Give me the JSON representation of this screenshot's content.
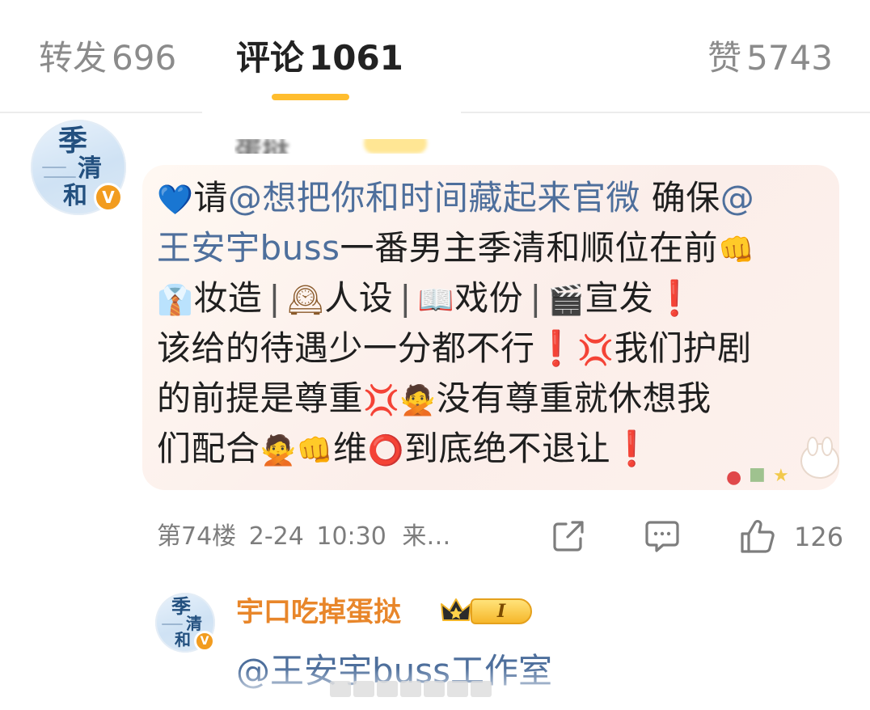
{
  "tabs": {
    "repost": {
      "label": "转发",
      "count": "696"
    },
    "comments": {
      "label": "评论",
      "count": "1061"
    },
    "likes": {
      "label": "赞",
      "count": "5743"
    }
  },
  "comment": {
    "avatar_text": [
      "季",
      "清",
      "和"
    ],
    "verified_badge": "V",
    "username_blurred": "蛋挞",
    "lines": {
      "l1": {
        "emoji1": "💙",
        "t1": "请",
        "mention1": "@想把你和时间藏起来官微",
        "t2": " 确保",
        "mention2a": "@"
      },
      "l2": {
        "mention2b": "王安宇buss",
        "t1": "一番男主季清和顺位在前",
        "emoji1": "👊"
      },
      "l3": {
        "emoji1": "👔",
        "t1": "妆造",
        "sep1": "|",
        "emoji2": "🕰",
        "t2": "人设",
        "sep2": "|",
        "emoji3": "📖",
        "t3": "戏份",
        "sep3": "|",
        "emoji4": "🎬",
        "t4": "宣发",
        "emoji5": "❗"
      },
      "l4": {
        "t1": "该给的待遇少一分都不行",
        "emoji1": "❗",
        "emoji2": "💢",
        "t2": "我们护剧"
      },
      "l5": {
        "t1": "的前提是尊重",
        "emoji1": "💢",
        "emoji2": "🙅",
        "t2": "没有尊重就休想我"
      },
      "l6": {
        "t1": "们配合",
        "emoji1": "🙅",
        "emoji2": "👊",
        "t2": "维",
        "emoji3": "⭕",
        "t3": "到底绝不退让",
        "emoji4": "❗"
      }
    },
    "floor": "第74楼",
    "date": "2-24",
    "time": "10:30",
    "source": "来…",
    "like_count": "126"
  },
  "icons": {
    "share": "share-icon",
    "comment": "comment-icon",
    "like": "thumbs-up-icon",
    "crown": "crown-icon",
    "heart": "blue-heart-icon"
  },
  "reply": {
    "avatar_text": [
      "季",
      "清",
      "和"
    ],
    "verified_badge": "V",
    "username": "宇口吃掉蛋挞",
    "level": "I",
    "text": "@王安宇buss工作室"
  },
  "colors": {
    "accent": "#ffbd2e",
    "mention": "#4e6f9c",
    "reply_name": "#e8862a",
    "meta": "#7d7d7d",
    "verified": "#f29c1f",
    "bubble": "#fbeeea"
  }
}
